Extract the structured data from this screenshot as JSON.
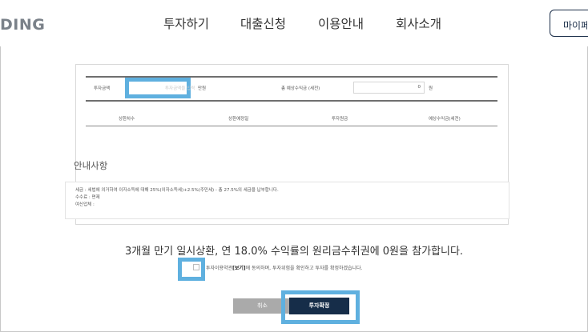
{
  "header": {
    "logo_text": "DING",
    "nav": [
      "투자하기",
      "대출신청",
      "이용안내",
      "회사소개"
    ],
    "mypage_label": "마이페이지"
  },
  "investment_form": {
    "amount_label": "투자금액",
    "amount_placeholder": "투자금액을 입력",
    "amount_unit": "만원",
    "expected_profit_label": "총 예상수익금 (세전)",
    "expected_profit_value": "0",
    "expected_profit_unit": "원"
  },
  "schedule_table": {
    "columns": [
      "상환차수",
      "상환예정일",
      "투자원금",
      "예상수익금(세전)"
    ]
  },
  "notice": {
    "title": "안내사항",
    "lines": [
      "세금 : 세법에 의거하여 이자소득에 대해 25%(이자소득세)+2.5%(주민세) - 총 27.5%의 세금을 납부합니다.",
      "수수료 : 면제",
      "여신업체 :"
    ]
  },
  "summary_text": "3개월 만기 일시상환, 연 18.0% 수익률의 원리금수취권에 0원을 참가합니다.",
  "agreement": {
    "prefix": "투자이용약관",
    "link": "[보기]",
    "suffix": "에 동의하며, 투자위험을 확인하고 투자를 확정하겠습니다."
  },
  "buttons": {
    "cancel": "취소",
    "confirm": "투자확정"
  },
  "colors": {
    "brand_navy": "#162d49",
    "highlight": "#5fb0df",
    "cancel_gray": "#aaaaaa"
  }
}
